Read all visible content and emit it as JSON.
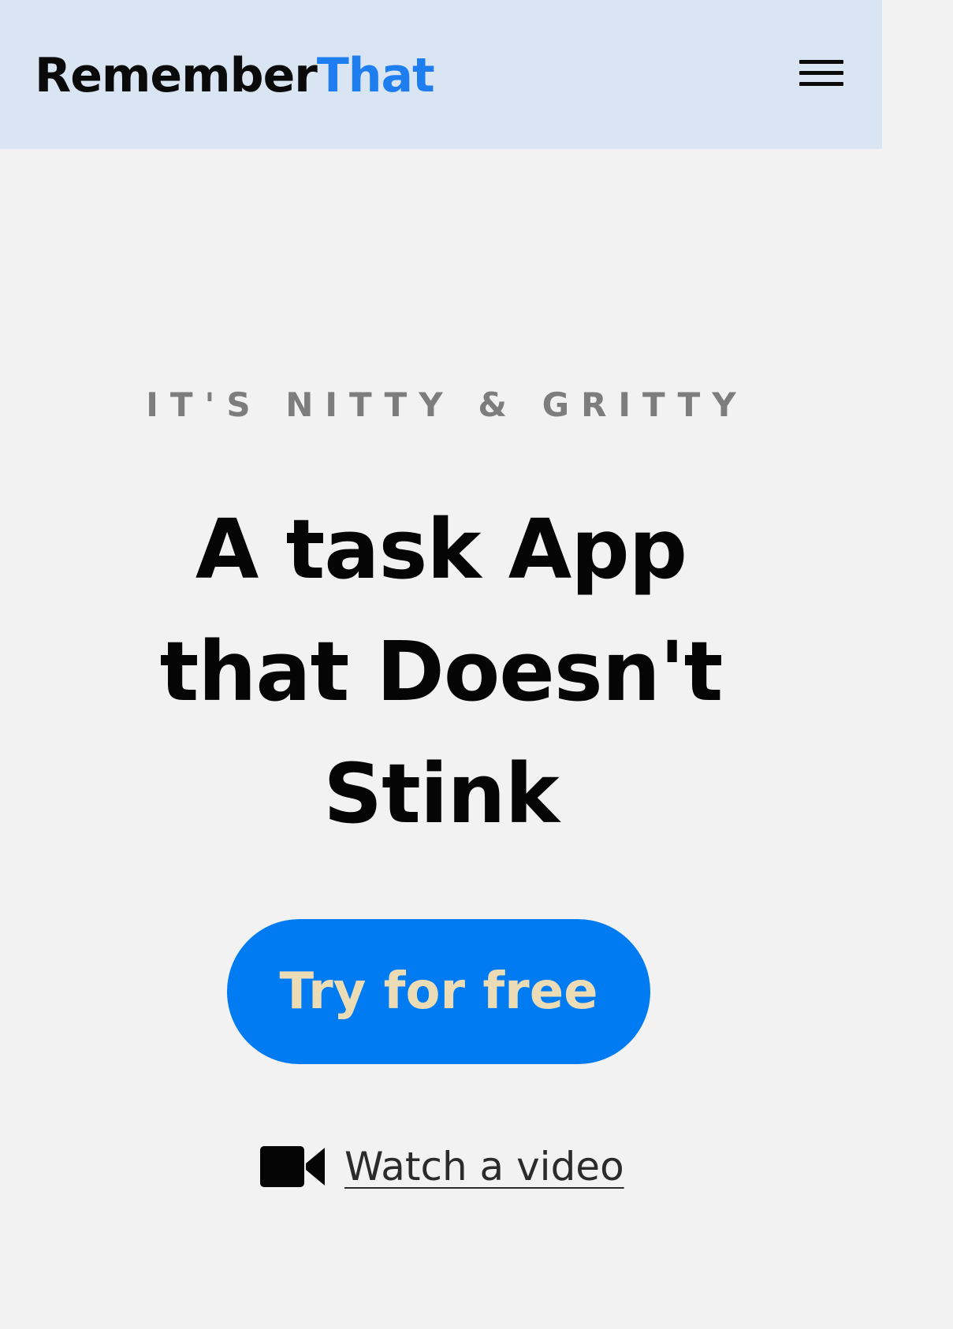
{
  "header": {
    "brand_part1": "Remember",
    "brand_part2": "That",
    "brand_part1_color": "#0a0a0a",
    "brand_part2_color": "#1e7ef0",
    "menu_icon": "hamburger-menu-icon",
    "background_color": "#dae5f3"
  },
  "hero": {
    "eyebrow": "IT'S NITTY & GRITTY",
    "headline_line1": "A task App",
    "headline_line2": "that Doesn't",
    "headline_line3": "Stink",
    "cta_label": "Try for free",
    "cta_color": "#007bf2",
    "cta_text_color": "#ebdcb6",
    "video_icon": "video-camera-icon",
    "video_label": "Watch a video"
  }
}
